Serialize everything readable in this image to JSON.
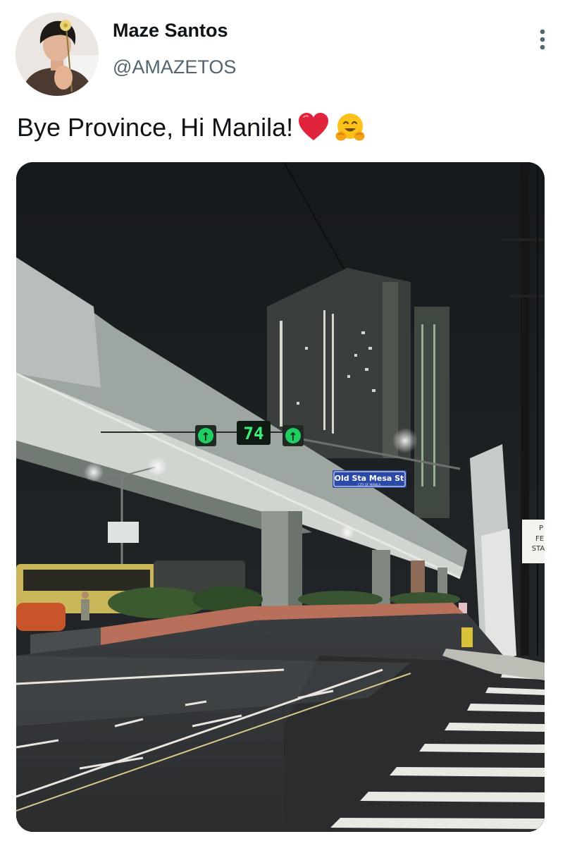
{
  "tweet": {
    "author": {
      "display_name": "Maze Santos",
      "handle": "@AMAZETOS"
    },
    "text": "Bye Province, Hi Manila!",
    "emojis": [
      "red-heart-icon",
      "hugging-face-icon"
    ],
    "menu_icon": "more-vertical-icon",
    "photo": {
      "signals": {
        "countdown": "74",
        "left_arrow": "↑",
        "right_arrow": "↑"
      },
      "street_sign": "Old Sta Mesa St",
      "street_sign_sub": "CITY OF MANILA",
      "side_sign": [
        "P",
        "FE",
        "STA"
      ]
    }
  }
}
